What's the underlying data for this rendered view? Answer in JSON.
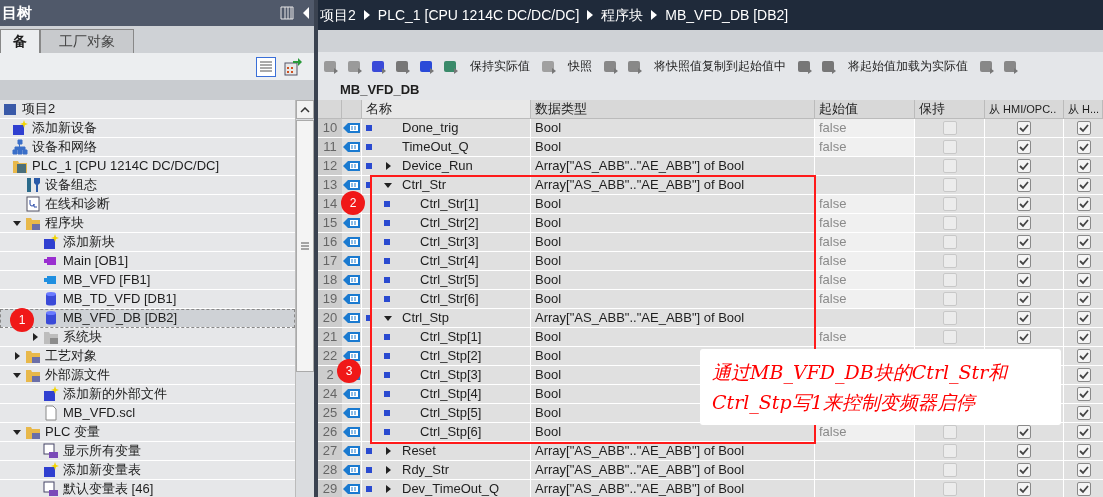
{
  "project_tree": {
    "title": "目树",
    "tabs": [
      {
        "label": "备",
        "selected": true
      },
      {
        "label": "工厂对象",
        "selected": false
      }
    ],
    "items": [
      {
        "label": "项目2",
        "kind": "project",
        "selected": false,
        "children": [
          {
            "label": "添加新设备",
            "kind": "add",
            "selected": false
          },
          {
            "label": "设备和网络",
            "kind": "network",
            "selected": false
          },
          {
            "label": "PLC_1 [CPU 1214C DC/DC/DC]",
            "kind": "plc",
            "selected": false,
            "children": [
              {
                "label": "设备组态",
                "kind": "config",
                "selected": false
              },
              {
                "label": "在线和诊断",
                "kind": "diag",
                "selected": false
              },
              {
                "label": "程序块",
                "kind": "folder",
                "expanded": true,
                "selected": false,
                "children": [
                  {
                    "label": "添加新块",
                    "kind": "add",
                    "selected": false
                  },
                  {
                    "label": "Main [OB1]",
                    "kind": "ob",
                    "selected": false
                  },
                  {
                    "label": "MB_VFD [FB1]",
                    "kind": "fb",
                    "selected": false
                  },
                  {
                    "label": "MB_TD_VFD [DB1]",
                    "kind": "db",
                    "selected": false
                  },
                  {
                    "label": "MB_VFD_DB [DB2]",
                    "kind": "db",
                    "selected": true
                  },
                  {
                    "label": "系统块",
                    "kind": "sysfolder",
                    "expanded": false,
                    "selected": false
                  }
                ]
              },
              {
                "label": "工艺对象",
                "kind": "folder",
                "expanded": false,
                "selected": false
              },
              {
                "label": "外部源文件",
                "kind": "folder",
                "expanded": true,
                "selected": false,
                "children": [
                  {
                    "label": "添加新的外部文件",
                    "kind": "add",
                    "selected": false
                  },
                  {
                    "label": "MB_VFD.scl",
                    "kind": "file",
                    "selected": false
                  }
                ]
              },
              {
                "label": "PLC 变量",
                "kind": "folder",
                "expanded": true,
                "selected": false,
                "children": [
                  {
                    "label": "显示所有变量",
                    "kind": "tags",
                    "selected": false
                  },
                  {
                    "label": "添加新变量表",
                    "kind": "add",
                    "selected": false
                  },
                  {
                    "label": "默认变量表 [46]",
                    "kind": "tags",
                    "selected": false
                  }
                ]
              }
            ]
          }
        ]
      }
    ]
  },
  "breadcrumb": [
    "项目2",
    "PLC_1 [CPU 1214C DC/DC/DC]",
    "程序块",
    "MB_VFD_DB [DB2]"
  ],
  "toolbar": [
    "保持实际值",
    "快照",
    "将快照值复制到起始值中",
    "将起始值加载为实际值"
  ],
  "block_title": "MB_VFD_DB",
  "table": {
    "columns": [
      "名称",
      "数据类型",
      "起始值",
      "保持",
      "从 HMI/OPC..",
      "从 H..."
    ],
    "rows": [
      {
        "num": "10",
        "name": "Done_trig",
        "type": "Bool",
        "start": "false",
        "retain": false,
        "hmi_accessible": true,
        "hmi_visible": true
      },
      {
        "num": "11",
        "name": "TimeOut_Q",
        "type": "Bool",
        "start": "false",
        "retain": false,
        "hmi_accessible": true,
        "hmi_visible": true
      },
      {
        "num": "12",
        "name": "Device_Run",
        "type": "Array[\"AS_ABB\"..\"AE_ABB\"] of Bool",
        "expanded": false,
        "retain": false,
        "hmi_accessible": true,
        "hmi_visible": true
      },
      {
        "num": "13",
        "name": "Ctrl_Str",
        "type": "Array[\"AS_ABB\"..\"AE_ABB\"] of Bool",
        "expanded": true,
        "retain": false,
        "hmi_accessible": true,
        "hmi_visible": true,
        "children": [
          {
            "num": "14",
            "name": "Ctrl_Str[1]",
            "type": "Bool",
            "start": "false",
            "retain": false,
            "hmi_accessible": true,
            "hmi_visible": true
          },
          {
            "num": "15",
            "name": "Ctrl_Str[2]",
            "type": "Bool",
            "start": "false",
            "retain": false,
            "hmi_accessible": true,
            "hmi_visible": true
          },
          {
            "num": "16",
            "name": "Ctrl_Str[3]",
            "type": "Bool",
            "start": "false",
            "retain": false,
            "hmi_accessible": true,
            "hmi_visible": true
          },
          {
            "num": "17",
            "name": "Ctrl_Str[4]",
            "type": "Bool",
            "start": "false",
            "retain": false,
            "hmi_accessible": true,
            "hmi_visible": true
          },
          {
            "num": "18",
            "name": "Ctrl_Str[5]",
            "type": "Bool",
            "start": "false",
            "retain": false,
            "hmi_accessible": true,
            "hmi_visible": true
          },
          {
            "num": "19",
            "name": "Ctrl_Str[6]",
            "type": "Bool",
            "start": "false",
            "retain": false,
            "hmi_accessible": true,
            "hmi_visible": true
          }
        ]
      },
      {
        "num": "20",
        "name": "Ctrl_Stp",
        "type": "Array[\"AS_ABB\"..\"AE_ABB\"] of Bool",
        "expanded": true,
        "retain": false,
        "hmi_accessible": true,
        "hmi_visible": true,
        "children": [
          {
            "num": "21",
            "name": "Ctrl_Stp[1]",
            "type": "Bool",
            "start": "false",
            "retain": false,
            "hmi_accessible": true,
            "hmi_visible": true
          },
          {
            "num": "22",
            "name": "Ctrl_Stp[2]",
            "type": "Bool",
            "hmi_visible": true
          },
          {
            "num": "2",
            "name": "Ctrl_Stp[3]",
            "type": "Bool",
            "hmi_visible": true
          },
          {
            "num": "24",
            "name": "Ctrl_Stp[4]",
            "type": "Bool",
            "hmi_visible": true
          },
          {
            "num": "25",
            "name": "Ctrl_Stp[5]",
            "type": "Bool",
            "hmi_visible": true
          },
          {
            "num": "26",
            "name": "Ctrl_Stp[6]",
            "type": "Bool",
            "start": "false",
            "retain": false,
            "hmi_accessible": true,
            "hmi_visible": true
          }
        ]
      },
      {
        "num": "27",
        "name": "Reset",
        "type": "Array[\"AS_ABB\"..\"AE_ABB\"] of Bool",
        "expanded": false,
        "retain": false,
        "hmi_accessible": true,
        "hmi_visible": true
      },
      {
        "num": "28",
        "name": "Rdy_Str",
        "type": "Array[\"AS_ABB\"..\"AE_ABB\"] of Bool",
        "expanded": false,
        "retain": false,
        "hmi_accessible": true,
        "hmi_visible": true
      },
      {
        "num": "29",
        "name": "Dev_TimeOut_Q",
        "type": "Array[\"AS_ABB\"..\"AE_ABB\"] of Bool",
        "expanded": false,
        "retain": false,
        "hmi_accessible": true,
        "hmi_visible": true
      }
    ]
  },
  "annotations": {
    "markers": [
      "1",
      "2",
      "3"
    ],
    "callout": [
      "通过MB_VFD_DB块的Ctrl_Str和",
      "Ctrl_Stp写1来控制变频器启停"
    ]
  }
}
